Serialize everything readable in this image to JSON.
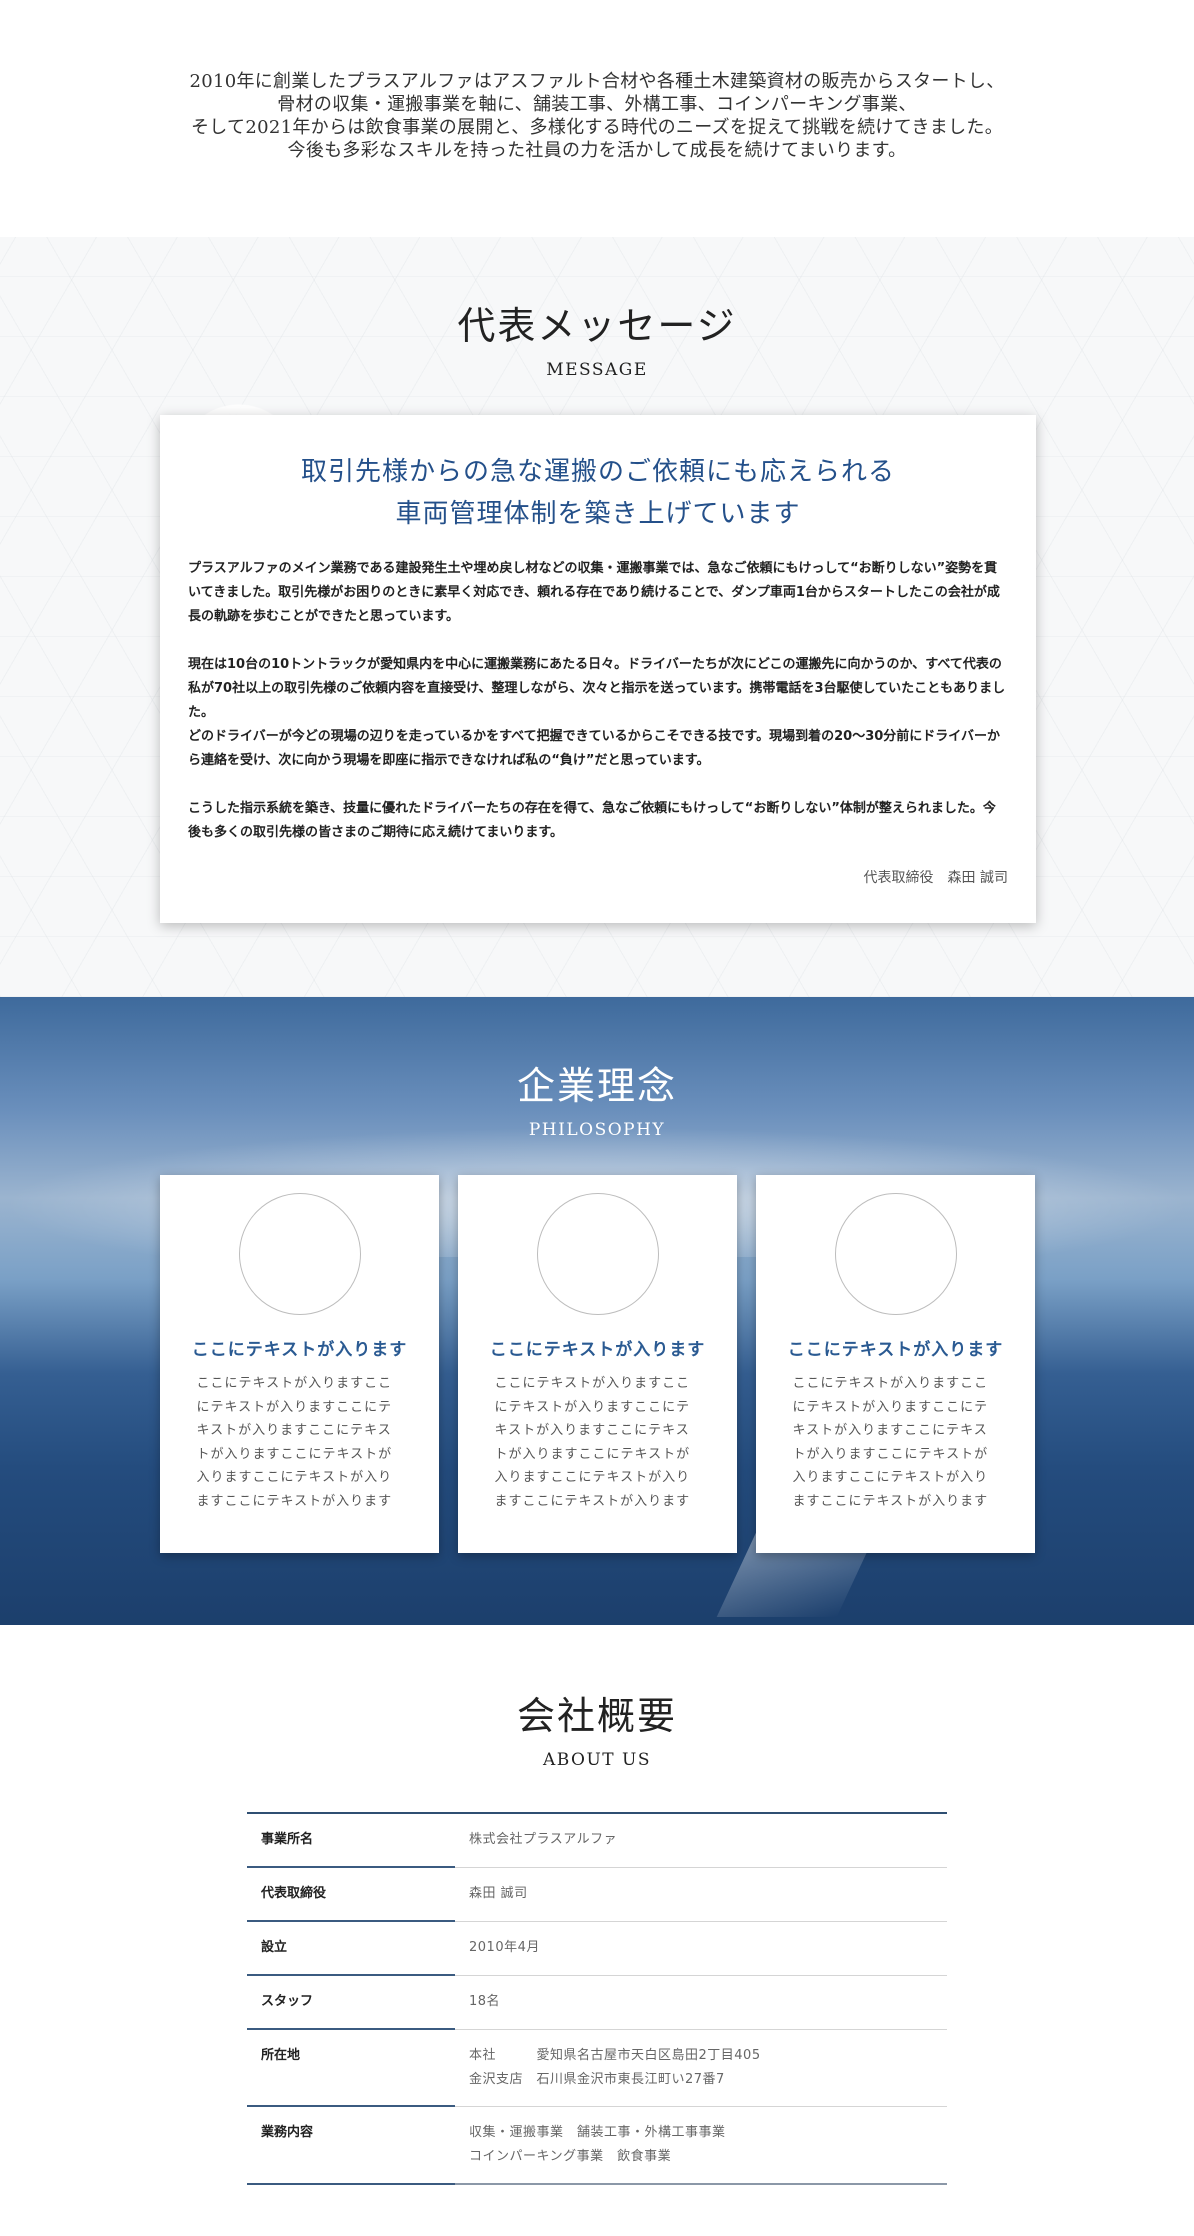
{
  "intro": {
    "lines": [
      "2010年に創業したプラスアルファはアスファルト合材や各種土木建築資材の販売からスタートし、",
      "骨材の収集・運搬事業を軸に、舗装工事、外構工事、コインパーキング事業、",
      "そして2021年からは飲食事業の展開と、多様化する時代のニーズを捉えて挑戦を続けてきました。",
      "今後も多彩なスキルを持った社員の力を活かして成長を続けてまいります。"
    ]
  },
  "message": {
    "title_ja": "代表メッセージ",
    "title_en": "MESSAGE",
    "heading_line1": "取引先様からの急な運搬のご依頼にも応えられる",
    "heading_line2": "車両管理体制を築き上げています",
    "paragraphs": [
      "プラスアルファのメイン業務である建設発生土や埋め戻し材などの収集・運搬事業では、急なご依頼にもけっして“お断りしない”姿勢を貫いてきました。取引先様がお困りのときに素早く対応でき、頼れる存在であり続けることで、ダンプ車両1台からスタートしたこの会社が成長の軌跡を歩むことができたと思っています。",
      "現在は10台の10トントラックが愛知県内を中心に運搬業務にあたる日々。ドライバーたちが次にどこの運搬先に向かうのか、すべて代表の私が70社以上の取引先様のご依頼内容を直接受け、整理しながら、次々と指示を送っています。携帯電話を3台駆使していたこともありました。",
      "どのドライバーが今どの現場の辺りを走っているかをすべて把握できているからこそできる技です。現場到着の20～30分前にドライバーから連絡を受け、次に向かう現場を即座に指示できなければ私の“負け”だと思っています。",
      "こうした指示系統を築き、技量に優れたドライバーたちの存在を得て、急なご依頼にもけっして“お断りしない”体制が整えられました。今後も多くの取引先様の皆さまのご期待に応え続けてまいります。"
    ],
    "signature": "代表取締役　森田 誠司"
  },
  "philosophy": {
    "title_ja": "企業理念",
    "title_en": "PHILOSOPHY",
    "cards": [
      {
        "heading": "ここにテキストが入ります",
        "body": "ここにテキストが入りますここにテキストが入りますここにテキストが入りますここにテキストが入りますここにテキストが入りますここにテキストが入りますここにテキストが入ります"
      },
      {
        "heading": "ここにテキストが入ります",
        "body": "ここにテキストが入りますここにテキストが入りますここにテキストが入りますここにテキストが入りますここにテキストが入りますここにテキストが入りますここにテキストが入ります"
      },
      {
        "heading": "ここにテキストが入ります",
        "body": "ここにテキストが入りますここにテキストが入りますここにテキストが入りますここにテキストが入りますここにテキストが入りますここにテキストが入りますここにテキストが入ります"
      }
    ]
  },
  "about": {
    "title_ja": "会社概要",
    "title_en": "ABOUT US",
    "rows": [
      {
        "key": "事業所名",
        "value1": "株式会社プラスアルファ",
        "value2": ""
      },
      {
        "key": "代表取締役",
        "value1": "森田 誠司",
        "value2": ""
      },
      {
        "key": "設立",
        "value1": "2010年4月",
        "value2": ""
      },
      {
        "key": "スタッフ",
        "value1": "18名",
        "value2": ""
      },
      {
        "key": "所在地",
        "value1": "本社　　　愛知県名古屋市天白区島田2丁目405",
        "value2": "金沢支店　石川県金沢市東長江町い27番7"
      },
      {
        "key": "業務内容",
        "value1": "収集・運搬事業　舗装工事・外構工事事業",
        "value2": "コインパーキング事業　飲食事業"
      }
    ]
  }
}
